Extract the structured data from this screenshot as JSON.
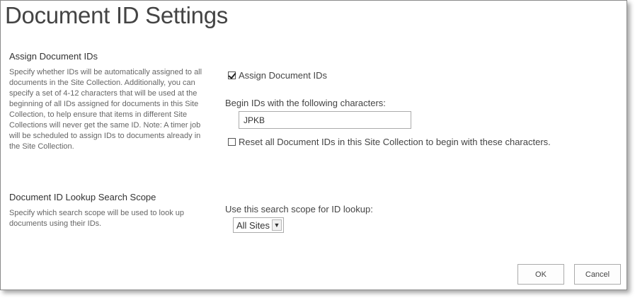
{
  "page": {
    "title": "Document ID Settings"
  },
  "assign_section": {
    "title": "Assign Document IDs",
    "description": "Specify whether IDs will be automatically assigned to all documents in the Site Collection. Additionally, you can specify a set of 4-12 characters that will be used at the beginning of all IDs assigned for documents in this Site Collection, to help ensure that items in different Site Collections will never get the same ID. Note: A timer job will be scheduled to assign IDs to documents already in the Site Collection.",
    "assign_checkbox_label": "Assign Document IDs",
    "assign_checked": true,
    "begin_label": "Begin IDs with the following characters:",
    "begin_value": "JPKB",
    "reset_checkbox_label": "Reset all Document IDs in this Site Collection to begin with these characters.",
    "reset_checked": false
  },
  "scope_section": {
    "title": "Document ID Lookup Search Scope",
    "description": "Specify which search scope will be used to look up documents using their IDs.",
    "scope_label": "Use this search scope for ID lookup:",
    "scope_value": "All Sites"
  },
  "buttons": {
    "ok": "OK",
    "cancel": "Cancel"
  }
}
